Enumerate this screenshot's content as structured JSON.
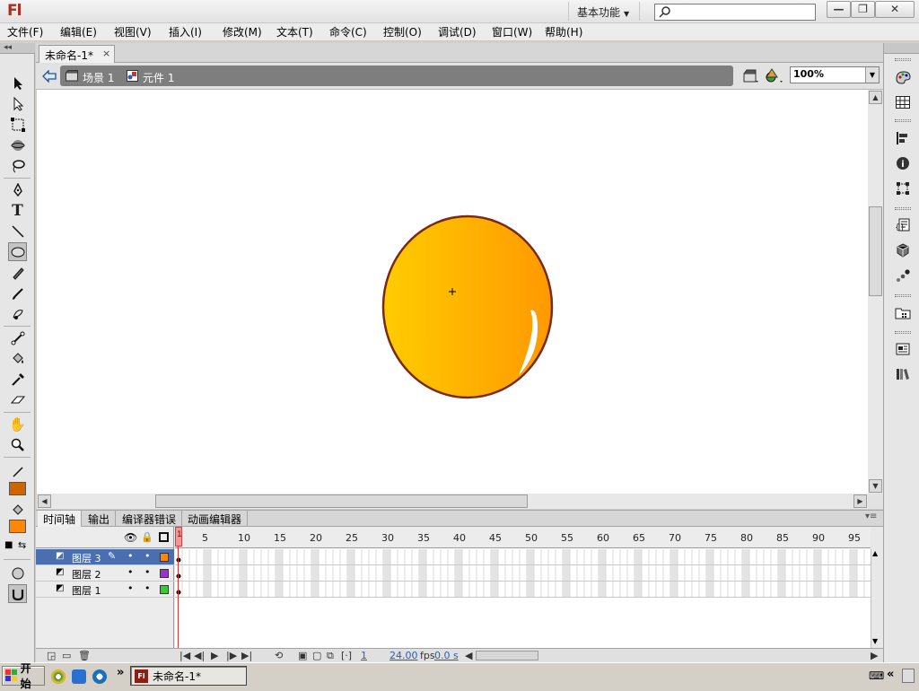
{
  "app": {
    "logo": "Fl",
    "workspace": "基本功能",
    "search_placeholder": ""
  },
  "window_buttons": {
    "minimize": "—",
    "restore": "❐",
    "close": "✕"
  },
  "menu": [
    "文件(F)",
    "编辑(E)",
    "视图(V)",
    "插入(I)",
    "修改(M)",
    "文本(T)",
    "命令(C)",
    "控制(O)",
    "调试(D)",
    "窗口(W)",
    "帮助(H)"
  ],
  "document": {
    "tab_label": "未命名-1*",
    "tab_close": "×",
    "breadcrumb": {
      "scene": "场景 1",
      "symbol": "元件 1"
    },
    "zoom": "100%"
  },
  "stage": {
    "background": "#ffffff",
    "ellipse_fill_start": "#ffcc00",
    "ellipse_fill_end": "#ff9900",
    "ellipse_stroke": "#7a2a14"
  },
  "timeline": {
    "tabs": [
      "时间轴",
      "输出",
      "编译器错误",
      "动画编辑器"
    ],
    "frame_numbers": [
      "1",
      "5",
      "10",
      "15",
      "20",
      "25",
      "30",
      "35",
      "40",
      "45",
      "50",
      "55",
      "60",
      "65",
      "70",
      "75",
      "80",
      "85",
      "90",
      "95"
    ],
    "layers": [
      {
        "name": "图层 3",
        "color": "#ff8800",
        "selected": true
      },
      {
        "name": "图层 2",
        "color": "#9933cc",
        "selected": false
      },
      {
        "name": "图层 1",
        "color": "#33cc33",
        "selected": false
      }
    ],
    "current_frame": "1",
    "fps": "24.00",
    "fps_unit": "fps",
    "time": "0.0 s"
  },
  "colors": {
    "stroke_swatch": "#cc6600",
    "fill_swatch": "#ff8800"
  },
  "taskbar": {
    "start_label": "开始",
    "task_label": "未命名-1*",
    "chevron": "»"
  }
}
